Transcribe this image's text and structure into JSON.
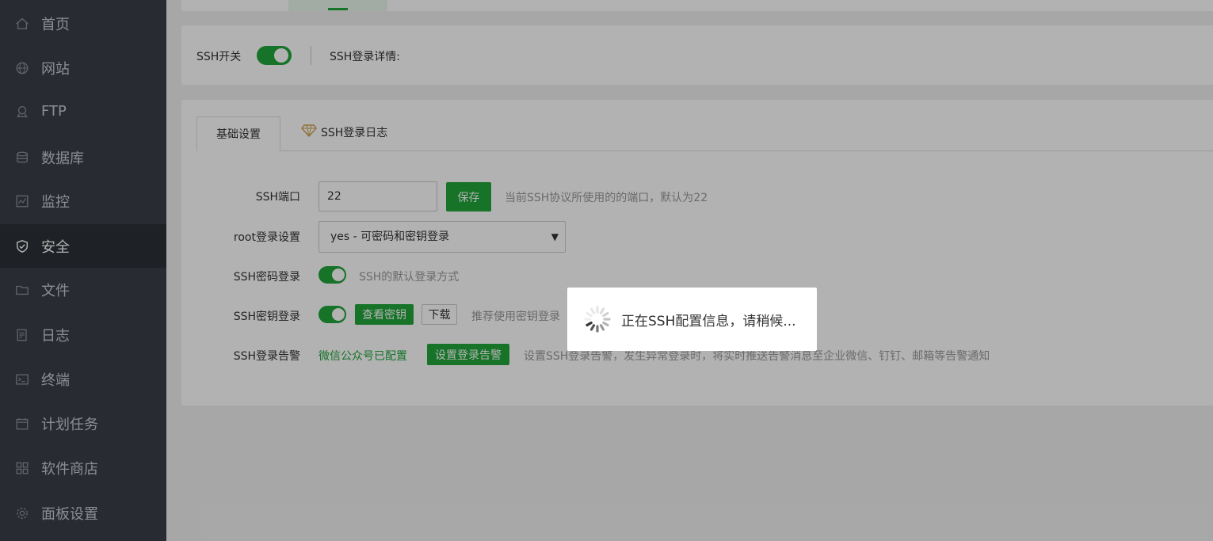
{
  "sidebar": {
    "items": [
      {
        "label": "首页",
        "icon": "home-icon",
        "active": false
      },
      {
        "label": "网站",
        "icon": "globe-icon",
        "active": false
      },
      {
        "label": "FTP",
        "icon": "ftp-icon",
        "active": false
      },
      {
        "label": "数据库",
        "icon": "database-icon",
        "active": false
      },
      {
        "label": "监控",
        "icon": "monitor-icon",
        "active": false
      },
      {
        "label": "安全",
        "icon": "shield-icon",
        "active": true
      },
      {
        "label": "文件",
        "icon": "folder-icon",
        "active": false
      },
      {
        "label": "日志",
        "icon": "log-icon",
        "active": false
      },
      {
        "label": "终端",
        "icon": "terminal-icon",
        "active": false
      },
      {
        "label": "计划任务",
        "icon": "calendar-icon",
        "active": false
      },
      {
        "label": "软件商店",
        "icon": "apps-icon",
        "active": false
      },
      {
        "label": "面板设置",
        "icon": "gear-icon",
        "active": false
      }
    ]
  },
  "ssh_switch": {
    "label": "SSH开关",
    "enabled": true,
    "details_label": "SSH登录详情:"
  },
  "tabs": {
    "basic": "基础设置",
    "log": "SSH登录日志"
  },
  "settings": {
    "port": {
      "label": "SSH端口",
      "value": "22",
      "save_label": "保存",
      "hint": "当前SSH协议所使用的的端口，默认为22"
    },
    "root_login": {
      "label": "root登录设置",
      "selected": "yes - 可密码和密钥登录"
    },
    "password_login": {
      "label": "SSH密码登录",
      "enabled": true,
      "hint": "SSH的默认登录方式"
    },
    "key_login": {
      "label": "SSH密钥登录",
      "enabled": true,
      "view_key_label": "查看密钥",
      "download_label": "下载",
      "hint": "推荐使用密钥登录"
    },
    "alert": {
      "label": "SSH登录告警",
      "status": "微信公众号已配置",
      "button_label": "设置登录告警",
      "hint": "设置SSH登录告警，发生异常登录时，将实时推送告警消息至企业微信、钉钉、邮箱等告警通知"
    }
  },
  "loading": {
    "text": "正在SSH配置信息，请稍候..."
  },
  "colors": {
    "accent": "#20a53a",
    "sidebar_bg": "#3a4048",
    "sidebar_active": "#2b3036"
  }
}
